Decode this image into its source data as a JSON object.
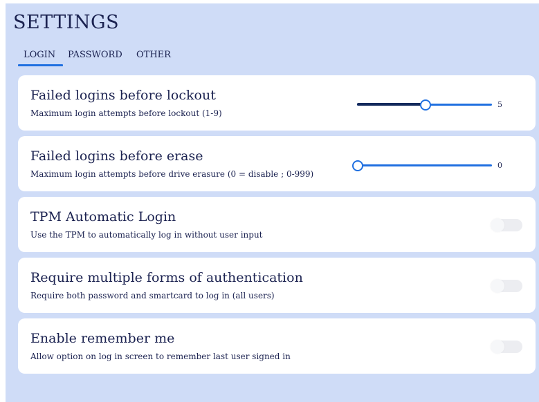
{
  "page": {
    "title": "SETTINGS"
  },
  "tabs": [
    {
      "label": "LOGIN",
      "active": true
    },
    {
      "label": "PASSWORD",
      "active": false
    },
    {
      "label": "OTHER",
      "active": false
    }
  ],
  "settings": {
    "lockout": {
      "title": "Failed logins before lockout",
      "description": "Maximum login attempts before lockout (1-9)",
      "value": "5",
      "min": 1,
      "max": 9
    },
    "erase": {
      "title": "Failed logins before erase",
      "description": "Maximum login attempts before drive erasure (0 = disable ; 0-999)",
      "value": "0",
      "min": 0,
      "max": 999
    },
    "tpm": {
      "title": "TPM Automatic Login",
      "description": "Use the TPM to automatically log in without user input",
      "enabled": false
    },
    "mfa": {
      "title": "Require multiple forms of authentication",
      "description": "Require both password and smartcard to log in (all users)",
      "enabled": false
    },
    "remember": {
      "title": "Enable remember me",
      "description": "Allow option on log in screen to remember last user signed in",
      "enabled": false
    }
  },
  "colors": {
    "background": "#cfdcf7",
    "accent": "#1f6fe0",
    "slider_fill": "#142a5c",
    "text": "#1b2250",
    "card": "#ffffff",
    "toggle_off": "#ecedf1"
  }
}
